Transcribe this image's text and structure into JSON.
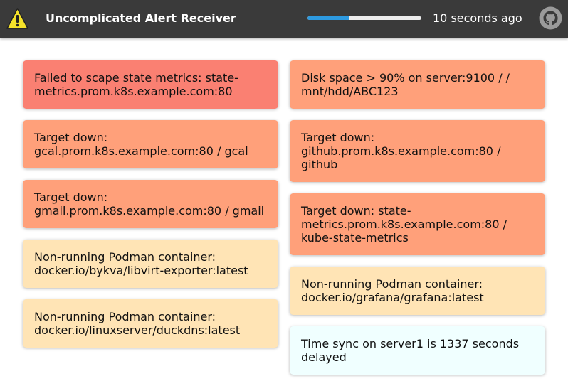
{
  "header": {
    "title": "Uncomplicated Alert Receiver",
    "last_updated": "10 seconds ago",
    "refresh_progress": 0.37,
    "logo_icon": "warning-triangle-icon",
    "repo_icon": "github-icon"
  },
  "colors": {
    "header_bg": "#3a3a3a",
    "progress": "#2d9ae0",
    "critical": "#fa8072",
    "error": "#ffa07a",
    "warning": "#ffe4b5",
    "info": "#f0ffff"
  },
  "alerts": {
    "left": [
      {
        "severity": "critical",
        "text": "Failed to scape state metrics: state-metrics.prom.k8s.example.com:80"
      },
      {
        "severity": "error",
        "text": "Target down: gcal.prom.k8s.example.com:80 / gcal"
      },
      {
        "severity": "error",
        "text": "Target down: gmail.prom.k8s.example.com:80 / gmail"
      },
      {
        "severity": "warning",
        "text": "Non-running Podman container: docker.io/bykva/libvirt-exporter:latest"
      },
      {
        "severity": "warning",
        "text": "Non-running Podman container: docker.io/linuxserver/duckdns:latest"
      }
    ],
    "right": [
      {
        "severity": "error",
        "text": "Disk space > 90% on server:9100 / / mnt/hdd/ABC123"
      },
      {
        "severity": "error",
        "text": "Target down: github.prom.k8s.example.com:80 / github"
      },
      {
        "severity": "error",
        "text": "Target down: state-metrics.prom.k8s.example.com:80 / kube-state-metrics"
      },
      {
        "severity": "warning",
        "text": "Non-running Podman container: docker.io/grafana/grafana:latest"
      },
      {
        "severity": "info",
        "text": "Time sync on server1 is 1337 seconds delayed"
      }
    ]
  }
}
